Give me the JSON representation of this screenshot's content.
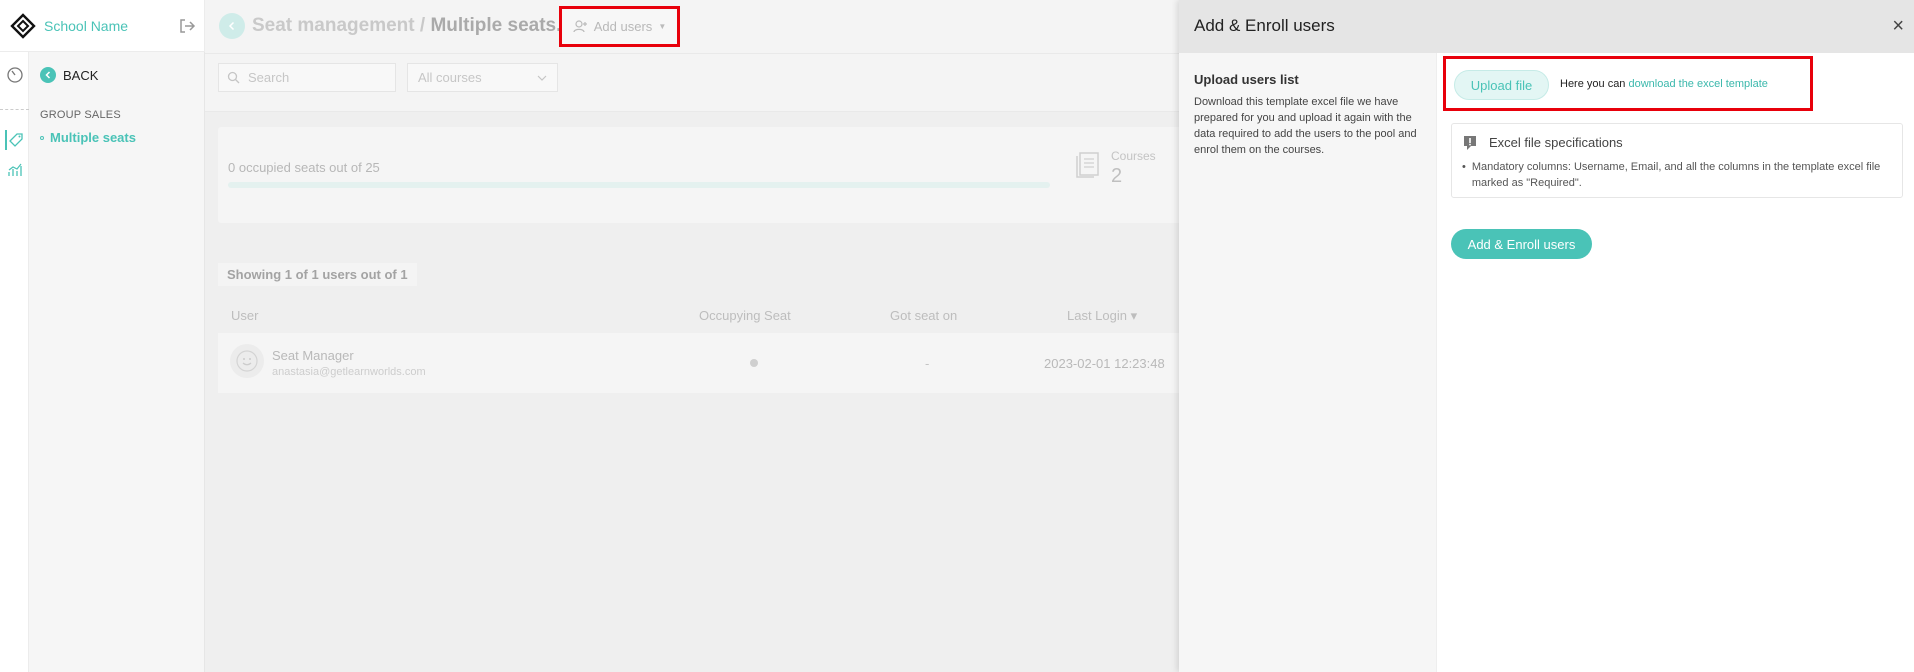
{
  "brand": {
    "name": "School Name"
  },
  "sidebar": {
    "back_label": "BACK",
    "section_label": "GROUP SALES",
    "items": [
      {
        "label": "Multiple seats"
      }
    ]
  },
  "header": {
    "parent_crumb": "Seat management",
    "separator": " / ",
    "current_crumb": "Multiple seats...",
    "add_users_label": "Add users"
  },
  "filters": {
    "search_placeholder": "Search",
    "courses_selected": "All courses"
  },
  "seats": {
    "summary": "0 occupied seats out of 25",
    "occupied_fraction": 0,
    "courses_label": "Courses",
    "courses_count": "2"
  },
  "users": {
    "showing_text": "Showing 1 of 1 users out of 1",
    "columns": [
      "User",
      "Occupying Seat",
      "Got seat on",
      "Last Login ▾"
    ],
    "rows": [
      {
        "name": "Seat Manager",
        "email": "anastasia@getlearnworlds.com",
        "got_seat_on": "-",
        "last_login": "2023-02-01 12:23:48"
      }
    ]
  },
  "drawer": {
    "title": "Add & Enroll users",
    "close_label": "×",
    "upload_heading": "Upload users list",
    "upload_description": "Download this template excel file we have prepared for you and upload it again with the data required to add the users to the pool and enrol them on the courses.",
    "upload_button": "Upload file",
    "hint_prefix": "Here you can ",
    "hint_link": "download the excel template",
    "spec_title": "Excel file specifications",
    "spec_item": "Mandatory columns: Username, Email, and all the columns in the template excel file marked as \"Required\".",
    "enroll_button": "Add & Enroll users"
  },
  "colors": {
    "accent": "#4ac3b7",
    "highlight": "#e8000b"
  }
}
